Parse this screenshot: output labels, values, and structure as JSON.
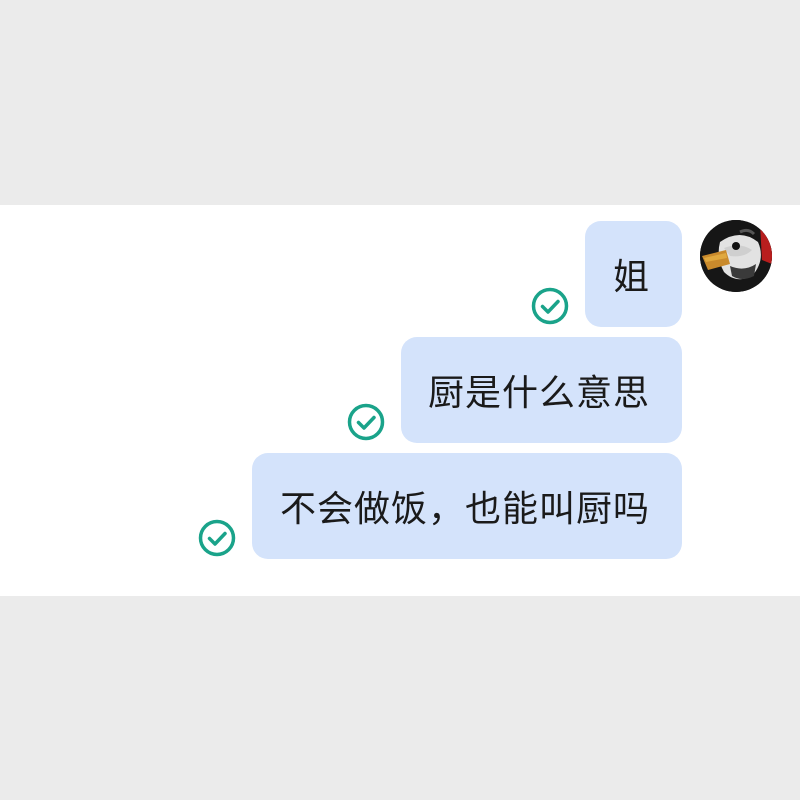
{
  "chat": {
    "messages": [
      {
        "text": "姐",
        "status_icon": "read-check-icon"
      },
      {
        "text": "厨是什么意思",
        "status_icon": "read-check-icon"
      },
      {
        "text": "不会做饭，也能叫厨吗",
        "status_icon": "read-check-icon"
      }
    ],
    "avatar_icon": "duck-avatar"
  },
  "colors": {
    "page_background": "#ebebeb",
    "chat_background": "#ffffff",
    "bubble": "#d4e3fb",
    "read_check": "#1aa38a",
    "text": "#1a1a1a"
  }
}
